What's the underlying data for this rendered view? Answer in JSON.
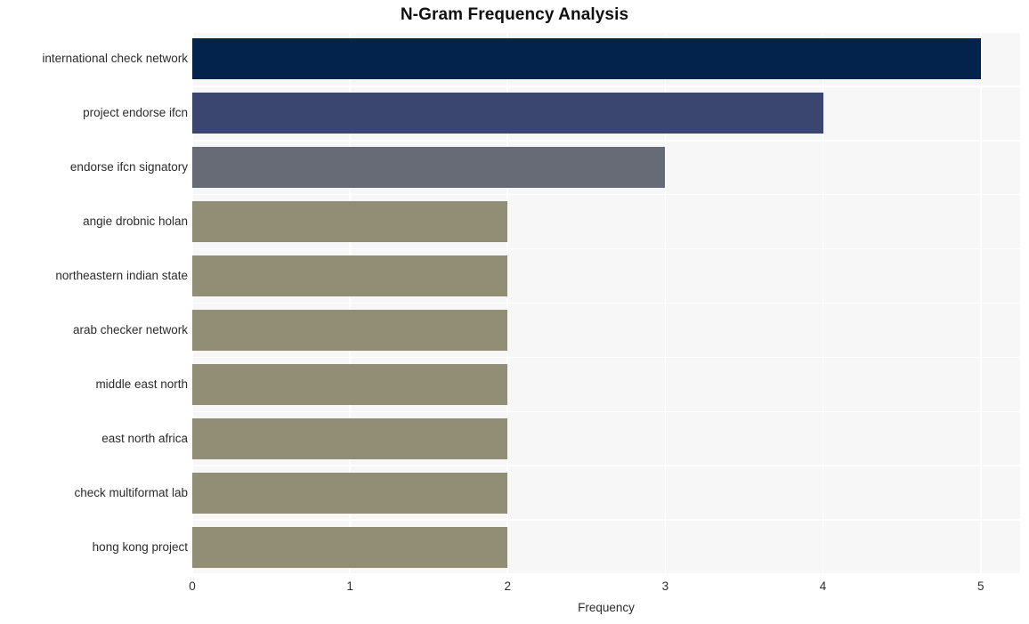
{
  "chart_data": {
    "type": "bar",
    "orientation": "horizontal",
    "title": "N-Gram Frequency Analysis",
    "xlabel": "Frequency",
    "ylabel": "",
    "categories": [
      "international check network",
      "project endorse ifcn",
      "endorse ifcn signatory",
      "angie drobnic holan",
      "northeastern indian state",
      "arab checker network",
      "middle east north",
      "east north africa",
      "check multiformat lab",
      "hong kong project"
    ],
    "values": [
      5,
      4,
      3,
      2,
      2,
      2,
      2,
      2,
      2,
      2
    ],
    "bar_colors": [
      "#03224c",
      "#3a4670",
      "#666b76",
      "#928d75",
      "#928d75",
      "#928d75",
      "#928d75",
      "#928d75",
      "#928d75",
      "#928d75"
    ],
    "xlim": [
      0,
      5.25
    ],
    "xticks": [
      0,
      1,
      2,
      3,
      4,
      5
    ],
    "xtick_labels": [
      "0",
      "1",
      "2",
      "3",
      "4",
      "5"
    ],
    "grid": true,
    "grid_color": "#ffffff",
    "plot_background": "#f7f7f7",
    "figure_background": "#ffffff",
    "legend": null
  }
}
